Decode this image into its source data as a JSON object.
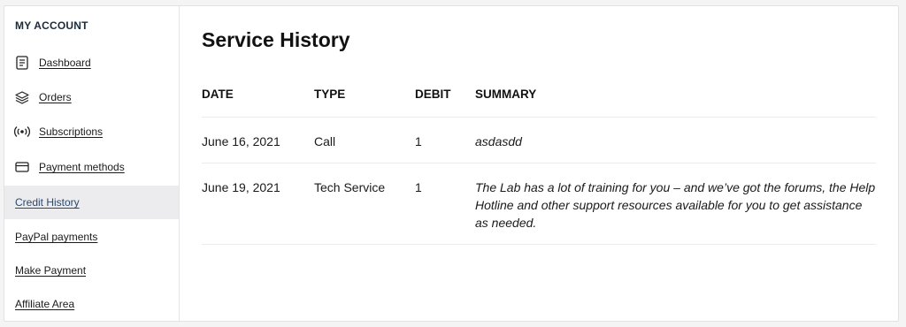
{
  "sidebar": {
    "heading": "MY ACCOUNT",
    "items": [
      {
        "label": "Dashboard",
        "icon": "dashboard-icon"
      },
      {
        "label": "Orders",
        "icon": "layers-icon"
      },
      {
        "label": "Subscriptions",
        "icon": "broadcast-icon"
      },
      {
        "label": "Payment methods",
        "icon": "credit-card-icon"
      },
      {
        "label": "Credit History",
        "active": true
      },
      {
        "label": "PayPal payments"
      },
      {
        "label": "Make Payment"
      },
      {
        "label": "Affiliate Area"
      }
    ]
  },
  "main": {
    "title": "Service History",
    "table": {
      "headers": [
        "DATE",
        "TYPE",
        "DEBIT",
        "SUMMARY"
      ],
      "rows": [
        {
          "date": "June 16, 2021",
          "type": "Call",
          "debit": "1",
          "summary": "asdasdd"
        },
        {
          "date": "June 19, 2021",
          "type": "Tech Service",
          "debit": "1",
          "summary": "The Lab has a lot of training for you – and we’ve got the forums, the Help Hotline and other support resources available for you to get assistance as needed."
        }
      ]
    }
  },
  "colors": {
    "active_bg": "#ececef",
    "active_text": "#2b4a6b",
    "page_bg": "#f4f4f5"
  }
}
